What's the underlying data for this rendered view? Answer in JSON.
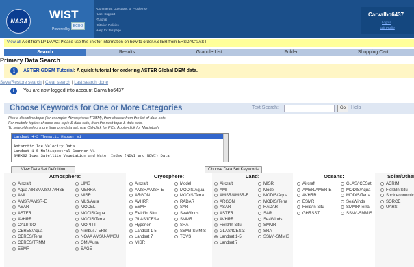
{
  "header": {
    "logo_text": "NASA",
    "app_name": "WIST",
    "echo_text": "ECHO",
    "powered_by": "Powered by",
    "links": [
      "•Comments, Questions, or Problems?",
      "•User Support",
      "•Tutorial",
      "•Citation Policies",
      "•Help for this page"
    ],
    "username": "Carvalho6437",
    "user_links": [
      "Logout",
      "Edit Profile"
    ]
  },
  "alert": {
    "link": "View all",
    "text": " Alert from LP DAAC: Please use this link for information on how to order ASTER from ERSDAC's AST"
  },
  "nav": {
    "tabs": [
      "Search",
      "Results",
      "Granule List",
      "Folder",
      "Shopping Cart"
    ],
    "active": 0
  },
  "page_title": "Primary Data Search",
  "tutorial": {
    "link": "ASTER GDEM Tutorial",
    "text": ": A quick tutorial for ordering ASTER Global DEM data."
  },
  "save_links": {
    "save": "Save/Restore search",
    "sep": " | ",
    "clear": "Clear search",
    "last": "Last search done"
  },
  "logged_in_text": "You are now logged into account Carvalho6437",
  "keywords": {
    "title": "Choose Keywords for One or More Categories",
    "text_search_label": "Text Search:",
    "go_label": "Go",
    "help_label": "Help",
    "instructions": [
      "Pick a discipline/topic (for example: Atmosphere:TRMM), then choose from the list of data sets.",
      "For multiple topics: choose one topic & data sets, then the next topic & data sets.",
      "To select/deselect more than one data set, use Ctrl-click for PCs; Apple-click for Macintosh"
    ],
    "inst_link": "select/deselect",
    "datasets": [
      "Landsat 4-5 Thematic Mapper V1",
      "",
      "Antarctic Ice Velocity Data",
      "Landsat 1-5 Multispectral Scanner V1",
      "SMEX02 Iowa Satellite Vegetation and Water Index (NDVI and NDWI) Data"
    ],
    "view_def_button": "View Data Set Definition",
    "choose_button": "Choose Data Set Keywords"
  },
  "categories": {
    "atmosphere": {
      "title": "Atmosphere:",
      "col1": [
        "Aircraft",
        "Aqua AIRS/AMSU-A/HSB",
        "AMI",
        "AMSR/AMSR-E",
        "ASAR",
        "ASTER",
        "AVHRR",
        "CALIPSO",
        "CERES/Aqua",
        "CERES/Terra",
        "CERES/TRMM",
        "ESMR"
      ],
      "col2": [
        "LIMS",
        "MERRA",
        "MISR",
        "MLS/Aura",
        "MODEL",
        "MODIS/Aqua",
        "MODIS/Terra",
        "MOPITT",
        "Nimbus7-ERB",
        "NOAA AMSU-A/MSU",
        "OMI/Aura",
        "SAGE"
      ]
    },
    "cryosphere": {
      "title": "Cryosphere:",
      "col1": [
        "Aircraft",
        "AMSR/AMSR-E",
        "ARGON",
        "AVHRR",
        "ESMR",
        "Field/In Situ",
        "GLAS/ICESat",
        "Hyperion",
        "Landsat 1-5",
        "Landsat 7",
        "MISR"
      ],
      "col2": [
        "Model",
        "MODIS/Aqua",
        "MODIS/Terra",
        "RADAR",
        "SAR",
        "SeaWinds",
        "SMMR",
        "SRA",
        "SSM/I-SMMIS",
        "TOVS"
      ]
    },
    "land": {
      "title": "Land:",
      "col1": [
        "Aircraft",
        "AMI",
        "AMSR/AMSR-E",
        "ARGON",
        "ASAR",
        "ASTER",
        "AVHRR",
        "Field/In Situ",
        "GLAS/ICESat",
        "Landsat 1-5",
        "Landsat 7"
      ],
      "col2": [
        "MISR",
        "Model",
        "MODIS/Aqua",
        "MODIS/Terra",
        "RADAR",
        "SAR",
        "SeaWinds",
        "SMMR",
        "SRA",
        "SSM/I-SMMIS"
      ],
      "selected": "Landsat 1-5"
    },
    "oceans": {
      "title": "Oceans:",
      "col1": [
        "Aircraft",
        "AMSR/AMSR-E",
        "AVHRR",
        "ESMR",
        "Field/In Situ",
        "GHRSST"
      ],
      "col2": [
        "GLAS/ICESat",
        "MODIS/Aqua",
        "MODIS/Terra",
        "SeaWinds",
        "SMMR/Terra",
        "SSM/I-SMMIS"
      ]
    },
    "solar": {
      "title": "Solar/Other:",
      "col1": [
        "ACRIM",
        "Field/In Situ",
        "Socioeconomic",
        "SORCE",
        "UARS"
      ]
    }
  }
}
